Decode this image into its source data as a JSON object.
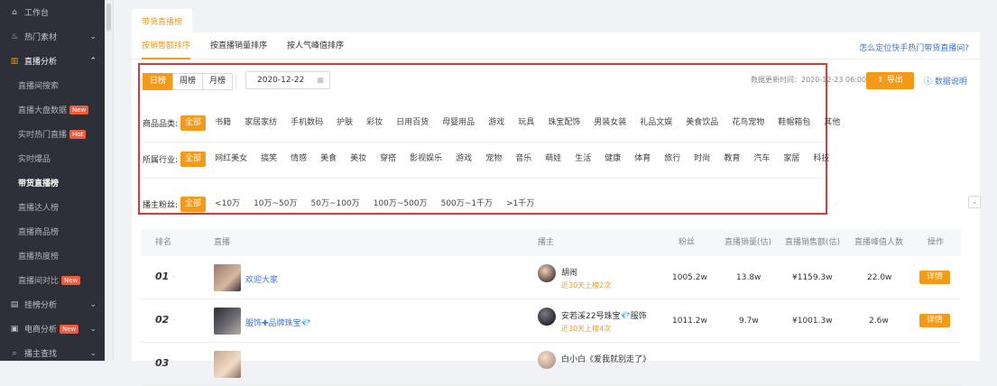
{
  "sidebar": {
    "items": [
      {
        "icon": "home-icon",
        "glyph": "⌂",
        "label": "工作台"
      },
      {
        "icon": "fire-icon",
        "glyph": "♨",
        "label": "热门素材"
      },
      {
        "icon": "chart-icon",
        "glyph": "▥",
        "label": "直播分析"
      }
    ],
    "subitems": [
      {
        "label": "直播间搜索",
        "badge": ""
      },
      {
        "label": "直播大盘数据",
        "badge": "New"
      },
      {
        "label": "实时热门直播",
        "badge": "Hot"
      },
      {
        "label": "实时爆品",
        "badge": ""
      },
      {
        "label": "带货直播榜",
        "badge": ""
      },
      {
        "label": "直播达人榜",
        "badge": ""
      },
      {
        "label": "直播商品榜",
        "badge": ""
      },
      {
        "label": "直播热度榜",
        "badge": ""
      },
      {
        "label": "直播间对比",
        "badge": "New"
      }
    ],
    "bottom": [
      {
        "icon": "bar-icon",
        "glyph": "▤",
        "label": "挂榜分析",
        "badge": ""
      },
      {
        "icon": "shop-icon",
        "glyph": "▣",
        "label": "电商分析",
        "badge": "New"
      },
      {
        "icon": "search-icon",
        "glyph": "⌕",
        "label": "播主查找",
        "badge": ""
      }
    ]
  },
  "page_tab": "带货直播榜",
  "subtabs": [
    "按销售额排序",
    "按直播销量排序",
    "按人气峰值排序"
  ],
  "help_link": "怎么定位快手热门带货直播间?",
  "range_buttons": [
    "日榜",
    "周榜",
    "月榜"
  ],
  "date": "2020-12-22",
  "updated": "数据更新时间：2020-12-23 06:00",
  "export_label": "导出",
  "explain_label": "数据说明",
  "filters": {
    "category": {
      "label": "商品品类:",
      "options": [
        "全部",
        "书籍",
        "家居家纺",
        "手机数码",
        "护肤",
        "彩妆",
        "日用百货",
        "母婴用品",
        "游戏",
        "玩具",
        "珠宝配饰",
        "男装女装",
        "礼品文娱",
        "美食饮品",
        "花鸟宠物",
        "鞋帽箱包",
        "其他"
      ]
    },
    "industry": {
      "label": "所属行业:",
      "options": [
        "全部",
        "网红美女",
        "搞笑",
        "情感",
        "美食",
        "美妆",
        "穿搭",
        "影视娱乐",
        "游戏",
        "宠物",
        "音乐",
        "萌娃",
        "生活",
        "健康",
        "体育",
        "旅行",
        "时尚",
        "教育",
        "汽车",
        "家居",
        "科技"
      ]
    },
    "fans": {
      "label": "播主粉丝:",
      "options": [
        "全部",
        "<10万",
        "10万~50万",
        "50万~100万",
        "100万~500万",
        "500万~1千万",
        ">1千万"
      ]
    }
  },
  "table": {
    "headers": [
      "排名",
      "直播",
      "播主",
      "粉丝",
      "直播销量(估)",
      "直播销售额(估)",
      "直播峰值人数",
      "操作"
    ],
    "rows": [
      {
        "rank": "01",
        "live": "欢迎大家",
        "anchor": "胡闹",
        "rise": "近30天上榜2次",
        "fans": "1005.2w",
        "sales": "13.8w",
        "revenue": "¥1159.3w",
        "peak": "22.0w",
        "action": "详情"
      },
      {
        "rank": "02",
        "live": "服饰✚品牌珠宝",
        "anchor": "安若溪22号珠宝",
        "anchor_suffix": "服饰",
        "rise": "近30天上榜4次",
        "fans": "1011.2w",
        "sales": "9.7w",
        "revenue": "¥1001.3w",
        "peak": "2.6w",
        "action": "详情"
      },
      {
        "rank": "03",
        "live": "",
        "anchor": "白小白《爱我就别走了》",
        "rise": "",
        "fans": "",
        "sales": "",
        "revenue": "",
        "peak": "",
        "action": ""
      }
    ]
  }
}
